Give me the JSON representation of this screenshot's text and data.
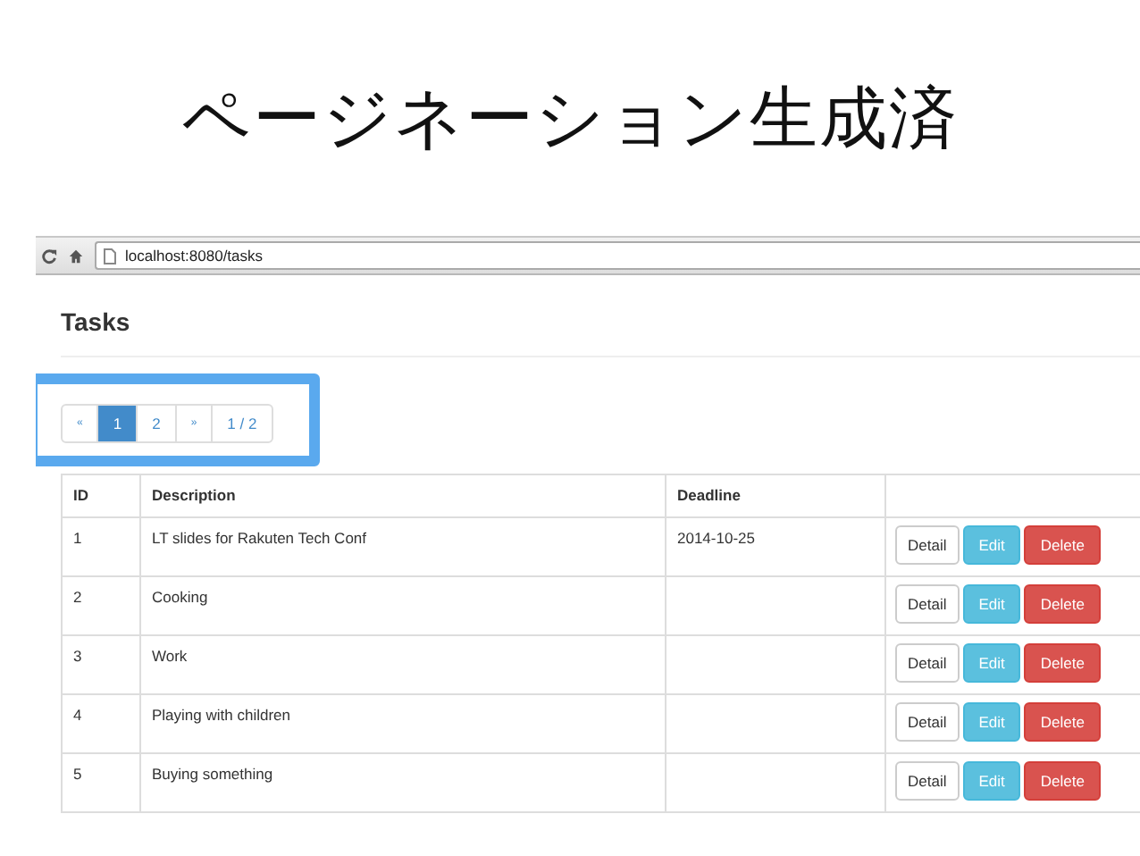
{
  "slide_title": "ページネーション生成済",
  "browser": {
    "url": "localhost:8080/tasks"
  },
  "page": {
    "heading": "Tasks"
  },
  "pagination": {
    "highlighted": true,
    "items": [
      {
        "label": "«",
        "selected": false
      },
      {
        "label": "1",
        "selected": true
      },
      {
        "label": "2",
        "selected": false
      },
      {
        "label": "»",
        "selected": false
      },
      {
        "label": "1 / 2",
        "selected": false
      }
    ]
  },
  "table": {
    "columns": [
      "ID",
      "Description",
      "Deadline"
    ],
    "rows": [
      {
        "id": "1",
        "description": "LT slides for Rakuten Tech Conf",
        "deadline": "2014-10-25",
        "actions": [
          {
            "label": "Detail",
            "kind": "default"
          },
          {
            "label": "Edit",
            "kind": "info"
          },
          {
            "label": "Delete",
            "kind": "danger"
          }
        ]
      },
      {
        "id": "2",
        "description": "Cooking",
        "actions": [
          {
            "label": "Detail",
            "kind": "default"
          },
          {
            "label": "Edit",
            "kind": "info"
          },
          {
            "label": "Delete",
            "kind": "danger"
          }
        ]
      },
      {
        "id": "3",
        "description": "Work",
        "actions": [
          {
            "label": "Detail",
            "kind": "default"
          },
          {
            "label": "Edit",
            "kind": "info"
          },
          {
            "label": "Delete",
            "kind": "danger"
          }
        ]
      },
      {
        "id": "4",
        "description": "Playing with children",
        "actions": [
          {
            "label": "Detail",
            "kind": "default"
          },
          {
            "label": "Edit",
            "kind": "info"
          },
          {
            "label": "Delete",
            "kind": "danger"
          }
        ]
      },
      {
        "id": "5",
        "description": "Buying something",
        "actions": [
          {
            "label": "Detail",
            "kind": "default"
          },
          {
            "label": "Edit",
            "kind": "info"
          },
          {
            "label": "Delete",
            "kind": "danger"
          }
        ]
      }
    ]
  }
}
